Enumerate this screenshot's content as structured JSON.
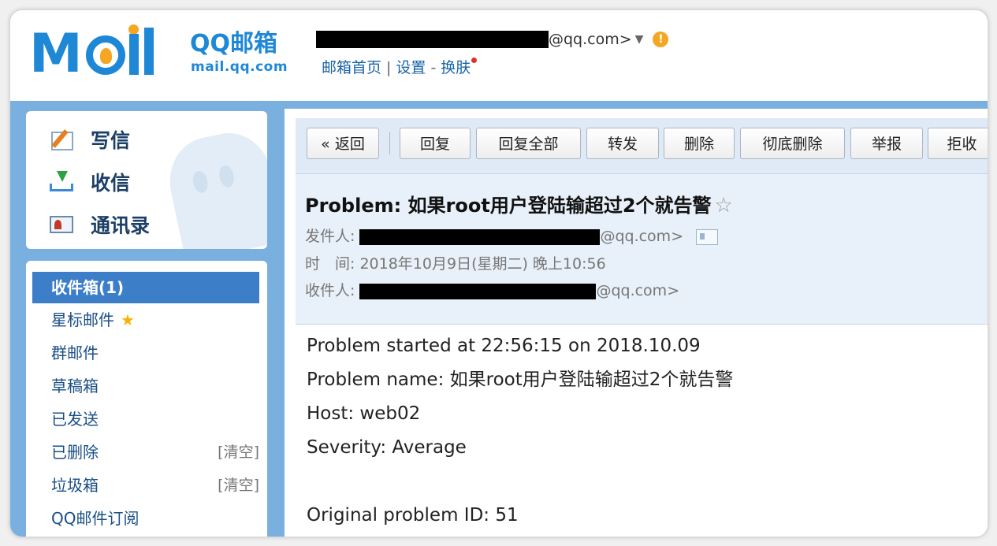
{
  "brand": {
    "logo_text": "MOIL",
    "title": "QQ邮箱",
    "subtitle": "mail.qq.com"
  },
  "account": {
    "email_suffix": "@qq.com>",
    "dropdown_arrow": "▼",
    "warn_badge": "!"
  },
  "top_links": {
    "home": "邮箱首页",
    "sep1": "|",
    "settings": "设置",
    "sep2": "-",
    "skin": "换肤"
  },
  "quick_actions": [
    {
      "label": "写信",
      "icon": "pencil-icon"
    },
    {
      "label": "收信",
      "icon": "inbox-download-icon"
    },
    {
      "label": "通讯录",
      "icon": "address-book-icon"
    }
  ],
  "folders": [
    {
      "label": "收件箱(1)",
      "active": true
    },
    {
      "label": "星标邮件",
      "star": "★"
    },
    {
      "label": "群邮件"
    },
    {
      "label": "草稿箱"
    },
    {
      "label": "已发送"
    },
    {
      "label": "已删除",
      "clear": "[清空]"
    },
    {
      "label": "垃圾箱",
      "clear": "[清空]"
    },
    {
      "label": "QQ邮件订阅"
    }
  ],
  "toolbar": {
    "back": "« 返回",
    "reply": "回复",
    "reply_all": "回复全部",
    "forward": "转发",
    "delete": "删除",
    "delete_permanent": "彻底删除",
    "report": "举报",
    "reject": "拒收"
  },
  "email": {
    "subject": "Problem: 如果root用户登陆输超过2个就告警",
    "star": "☆",
    "from_label": "发件人:",
    "from_suffix": "@qq.com>",
    "time_label": "时　间:",
    "time_value": "2018年10月9日(星期二) 晚上10:56",
    "to_label": "收件人:",
    "to_suffix": "@qq.com>",
    "body_lines": [
      "Problem started at 22:56:15 on 2018.10.09",
      "Problem name: 如果root用户登陆输超过2个就告警",
      "Host: web02",
      "Severity: Average",
      "",
      "Original problem ID: 51"
    ]
  }
}
